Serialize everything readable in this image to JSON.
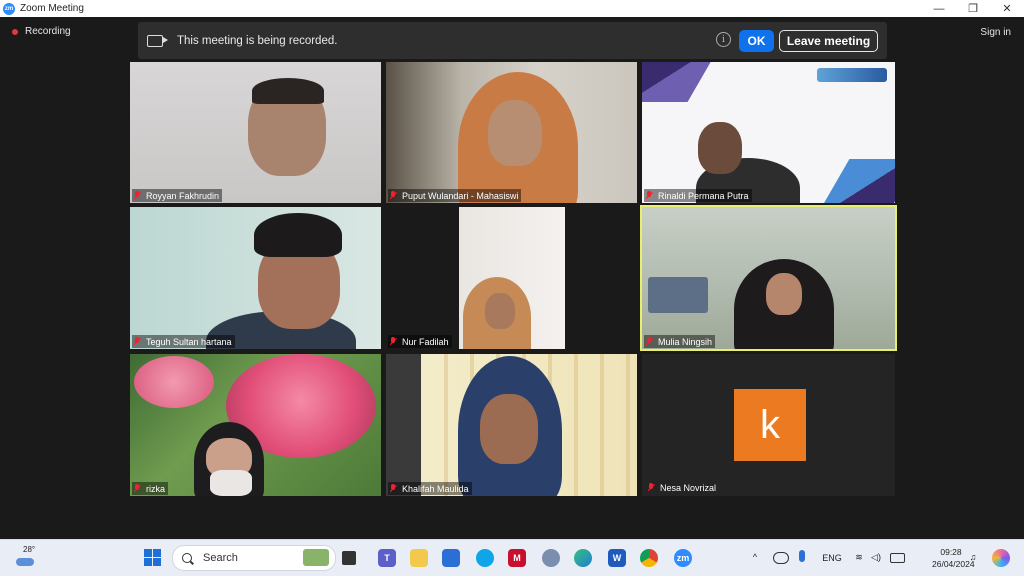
{
  "window": {
    "title": "Zoom Meeting",
    "controls": [
      "—",
      "❐",
      "✕"
    ]
  },
  "meeting": {
    "recording_label": "Recording",
    "signin_label": "Sign in",
    "banner": {
      "message": "This meeting is being recorded.",
      "info_symbol": "i",
      "ok_label": "OK",
      "leave_label": "Leave meeting"
    },
    "participants": [
      {
        "name": "Royyan Fakhrudin",
        "muted": true
      },
      {
        "name": "Puput Wulandari - Mahasiswi",
        "muted": true
      },
      {
        "name": "Rinaldi Permana Putra",
        "muted": true
      },
      {
        "name": "Teguh Sultan hartana",
        "muted": true
      },
      {
        "name": "Nur Fadilah",
        "muted": true
      },
      {
        "name": "Mulia Ningsih",
        "muted": true,
        "active_speaker": true
      },
      {
        "name": "rizka",
        "muted": true
      },
      {
        "name": "Khalifah Maulida",
        "muted": true
      },
      {
        "name": "Nesa Novrizal",
        "muted": true,
        "avatar_letter": "k",
        "avatar_color": "#ec7a21"
      }
    ],
    "accent_color": "#0e72ed",
    "active_speaker_color": "#e8ef6a",
    "recording_color": "#e0383e"
  },
  "taskbar": {
    "weather_temp": "28°",
    "search_placeholder": "Search",
    "apps": [
      "file-explorer-icon",
      "teams-icon",
      "folder-icon",
      "store-icon",
      "vscode-icon",
      "mcafee-icon",
      "browser-icon",
      "edge-icon",
      "word-icon",
      "chrome-icon",
      "zoom-icon"
    ],
    "language": "ENG",
    "time": "09:28",
    "date": "26/04/2024"
  }
}
